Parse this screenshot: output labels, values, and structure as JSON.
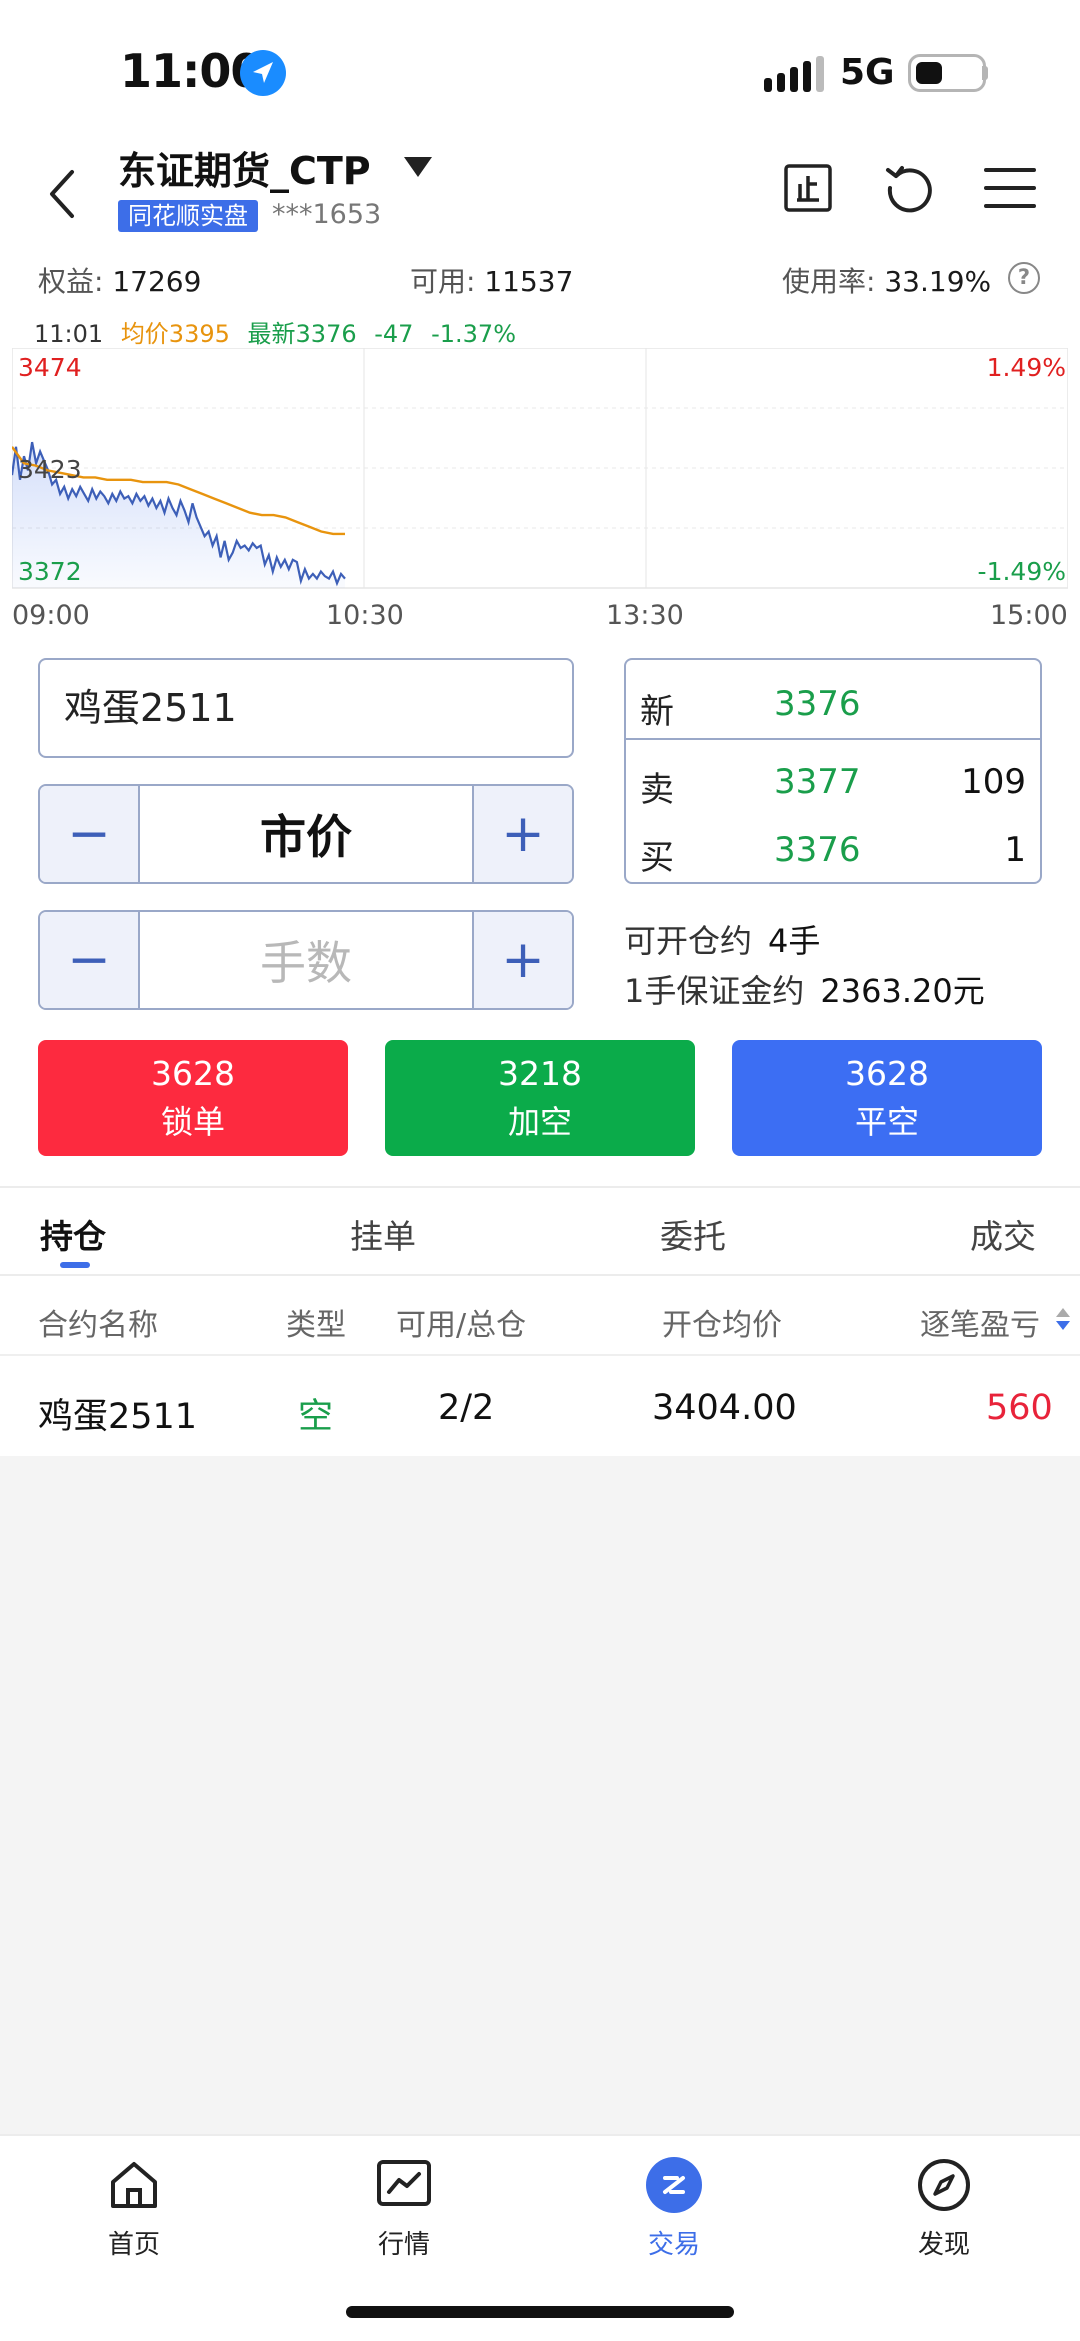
{
  "status_bar": {
    "time": "11:00",
    "network": "5G"
  },
  "header": {
    "account_title": "东证期货_CTP",
    "badge": "同花顺实盘",
    "account_number": "***1653"
  },
  "account": {
    "equity_label": "权益:",
    "equity_value": "17269",
    "available_label": "可用:",
    "available_value": "11537",
    "usage_label": "使用率:",
    "usage_value": "33.19%"
  },
  "chart_info": {
    "time": "11:01",
    "avg_label": "均价3395",
    "latest_label": "最新3376",
    "change": "-47",
    "change_pct": "-1.37%"
  },
  "chart_data": {
    "type": "line",
    "y_top": "3474",
    "y_mid": "3423",
    "y_bottom": "3372",
    "pct_top": "1.49%",
    "pct_bottom": "-1.49%",
    "ylim": [
      3372,
      3474
    ],
    "x_ticks": [
      "09:00",
      "10:30",
      "13:30",
      "15:00"
    ],
    "series": [
      {
        "values": [
          3420,
          3432,
          3418,
          3428,
          3422,
          3434,
          3425,
          3430,
          3426,
          3422,
          3416,
          3418,
          3412,
          3415,
          3410,
          3414,
          3411,
          3415,
          3412,
          3409,
          3414,
          3410,
          3413,
          3411,
          3408,
          3412,
          3409,
          3413,
          3410,
          3411,
          3408,
          3412,
          3409,
          3411,
          3407,
          3410,
          3406,
          3409,
          3404,
          3410,
          3406,
          3403,
          3409,
          3405,
          3400,
          3408,
          3402,
          3398,
          3394,
          3396,
          3390,
          3394,
          3385,
          3392,
          3384,
          3387,
          3392,
          3389,
          3390,
          3388,
          3391,
          3389,
          3390,
          3382,
          3386,
          3379,
          3385,
          3381,
          3384,
          3380,
          3384,
          3383,
          3375,
          3380,
          3376,
          3378,
          3376,
          3379,
          3377,
          3376,
          3379,
          3374,
          3378,
          3376
        ]
      },
      {
        "values": [
          3432,
          3425,
          3424,
          3422,
          3421,
          3420,
          3419,
          3419,
          3418,
          3418,
          3418,
          3417,
          3417,
          3417,
          3416,
          3414,
          3412,
          3410,
          3408,
          3406,
          3404,
          3403,
          3403,
          3402,
          3400,
          3398,
          3396,
          3395,
          3395
        ]
      }
    ]
  },
  "order": {
    "contract": "鸡蛋2511",
    "price_mode": "市价",
    "qty_placeholder": "手数",
    "minus": "−",
    "plus": "+"
  },
  "quote": {
    "rows": [
      {
        "label": "新",
        "price": "3376",
        "volume": ""
      },
      {
        "label": "卖",
        "price": "3377",
        "volume": "109"
      },
      {
        "label": "买",
        "price": "3376",
        "volume": "1"
      }
    ]
  },
  "open_info": {
    "can_open_label": "可开仓约",
    "can_open_value": "4手",
    "margin_label": "1手保证金约",
    "margin_value": "2363.20元"
  },
  "actions": [
    {
      "price": "3628",
      "label": "锁单",
      "color": "#fd2a3f"
    },
    {
      "price": "3218",
      "label": "加空",
      "color": "#0bab4a"
    },
    {
      "price": "3628",
      "label": "平空",
      "color": "#3c6ef3"
    }
  ],
  "tabs": [
    "持仓",
    "挂单",
    "委托",
    "成交"
  ],
  "positions": {
    "headers": [
      "合约名称",
      "类型",
      "可用/总仓",
      "开仓均价",
      "逐笔盈亏"
    ],
    "rows": [
      {
        "name": "鸡蛋2511",
        "type": "空",
        "avail_total": "2/2",
        "avg_price": "3404.00",
        "pnl": "560"
      }
    ]
  },
  "bottom_nav": [
    "首页",
    "行情",
    "交易",
    "发现"
  ]
}
